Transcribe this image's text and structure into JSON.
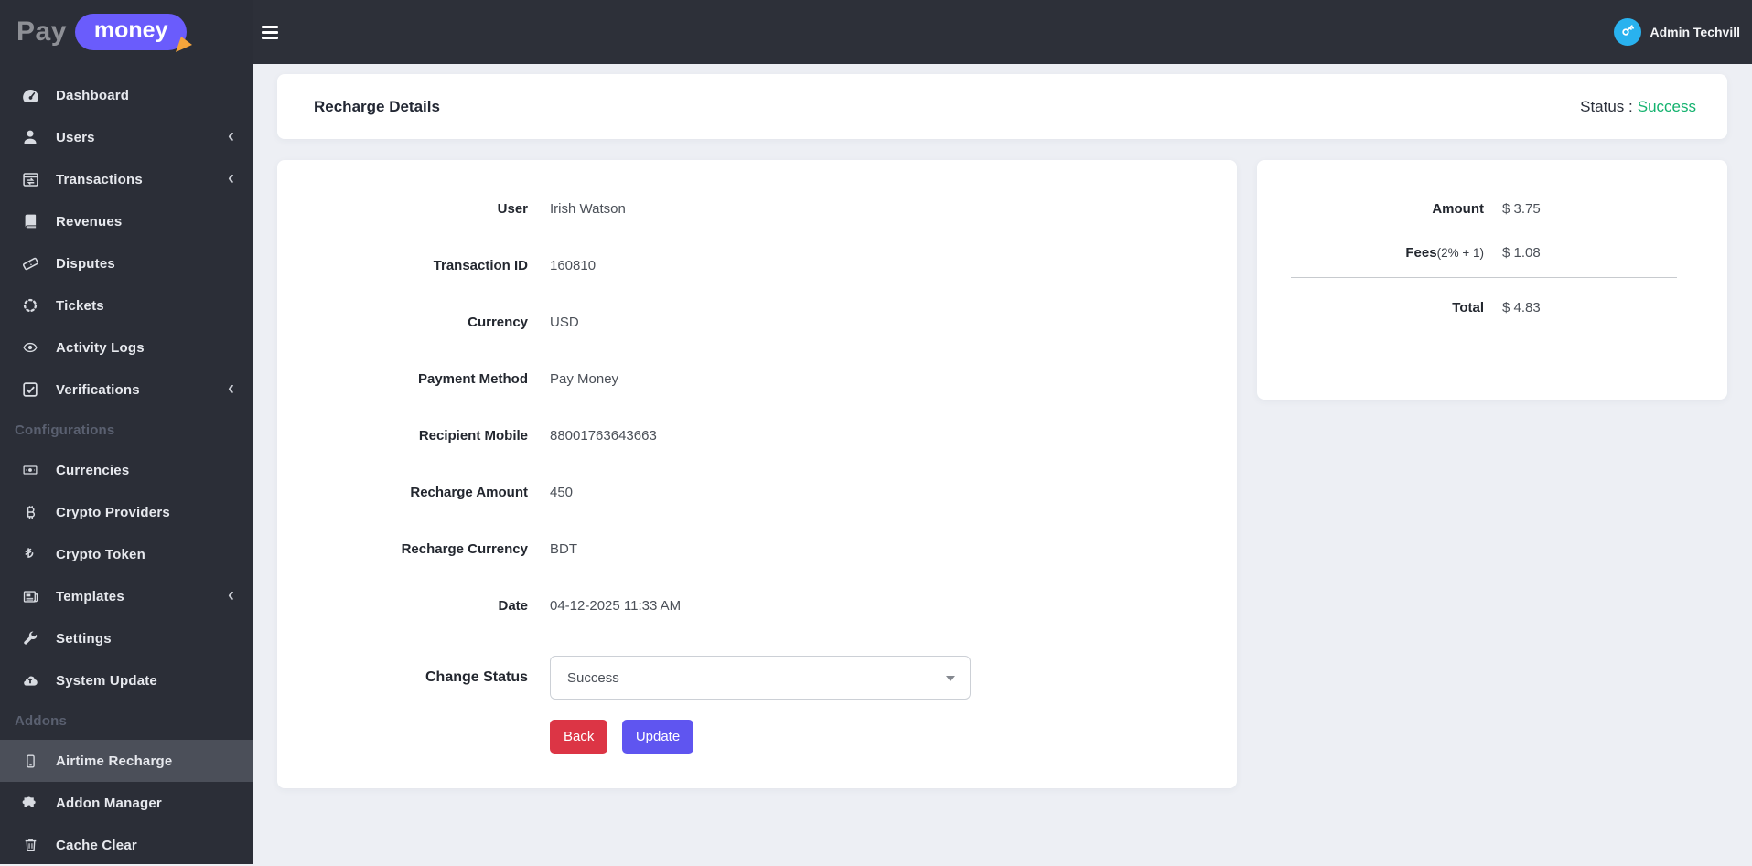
{
  "brand": {
    "pay": "Pay",
    "money": "money",
    "pill_color": "#6a5cfc",
    "cursor_color": "#f5a43b"
  },
  "topbar": {
    "user_name": "Admin Techvill",
    "avatar_color": "#29b2ef",
    "avatar_icon": "key-icon",
    "menu_icon": "hamburger-icon"
  },
  "sidebar": {
    "items": [
      {
        "type": "item",
        "label": "Dashboard",
        "icon": "dashboard-icon"
      },
      {
        "type": "item",
        "label": "Users",
        "icon": "users-icon",
        "chevron": true
      },
      {
        "type": "item",
        "label": "Transactions",
        "icon": "transactions-icon",
        "chevron": true
      },
      {
        "type": "item",
        "label": "Revenues",
        "icon": "revenues-icon"
      },
      {
        "type": "item",
        "label": "Disputes",
        "icon": "disputes-icon"
      },
      {
        "type": "item",
        "label": "Tickets",
        "icon": "tickets-icon"
      },
      {
        "type": "item",
        "label": "Activity Logs",
        "icon": "activity-logs-icon"
      },
      {
        "type": "item",
        "label": "Verifications",
        "icon": "verifications-icon",
        "chevron": true
      },
      {
        "type": "section",
        "label": "Configurations"
      },
      {
        "type": "item",
        "label": "Currencies",
        "icon": "currencies-icon"
      },
      {
        "type": "item",
        "label": "Crypto Providers",
        "icon": "crypto-providers-icon"
      },
      {
        "type": "item",
        "label": "Crypto Token",
        "icon": "crypto-token-icon"
      },
      {
        "type": "item",
        "label": "Templates",
        "icon": "templates-icon",
        "chevron": true
      },
      {
        "type": "item",
        "label": "Settings",
        "icon": "settings-icon"
      },
      {
        "type": "item",
        "label": "System Update",
        "icon": "system-update-icon"
      },
      {
        "type": "section",
        "label": "Addons"
      },
      {
        "type": "item",
        "label": "Airtime Recharge",
        "icon": "airtime-recharge-icon",
        "active": true
      },
      {
        "type": "item",
        "label": "Addon Manager",
        "icon": "addon-manager-icon"
      },
      {
        "type": "item",
        "label": "Cache Clear",
        "icon": "cache-clear-icon"
      }
    ]
  },
  "page": {
    "title": "Recharge Details",
    "status_label": "Status :",
    "status_value": "Success",
    "status_color": "#13b26e"
  },
  "details": {
    "fields": [
      {
        "label": "User",
        "value": "Irish Watson"
      },
      {
        "label": "Transaction ID",
        "value": "160810"
      },
      {
        "label": "Currency",
        "value": "USD"
      },
      {
        "label": "Payment Method",
        "value": "Pay Money"
      },
      {
        "label": "Recipient Mobile",
        "value": "88001763643663"
      },
      {
        "label": "Recharge Amount",
        "value": "450"
      },
      {
        "label": "Recharge Currency",
        "value": "BDT"
      },
      {
        "label": "Date",
        "value": "04-12-2025 11:33 AM"
      }
    ],
    "change_status": {
      "label": "Change Status",
      "selected": "Success"
    },
    "buttons": {
      "back": "Back",
      "update": "Update",
      "back_color": "#dc3545",
      "update_color": "#5f55f0"
    }
  },
  "summary": {
    "rows": [
      {
        "label": "Amount",
        "note": "",
        "value": "$ 3.75"
      },
      {
        "label": "Fees",
        "note": "(2% + 1)",
        "value": "$ 1.08"
      }
    ],
    "total": {
      "label": "Total",
      "value": "$ 4.83"
    }
  }
}
